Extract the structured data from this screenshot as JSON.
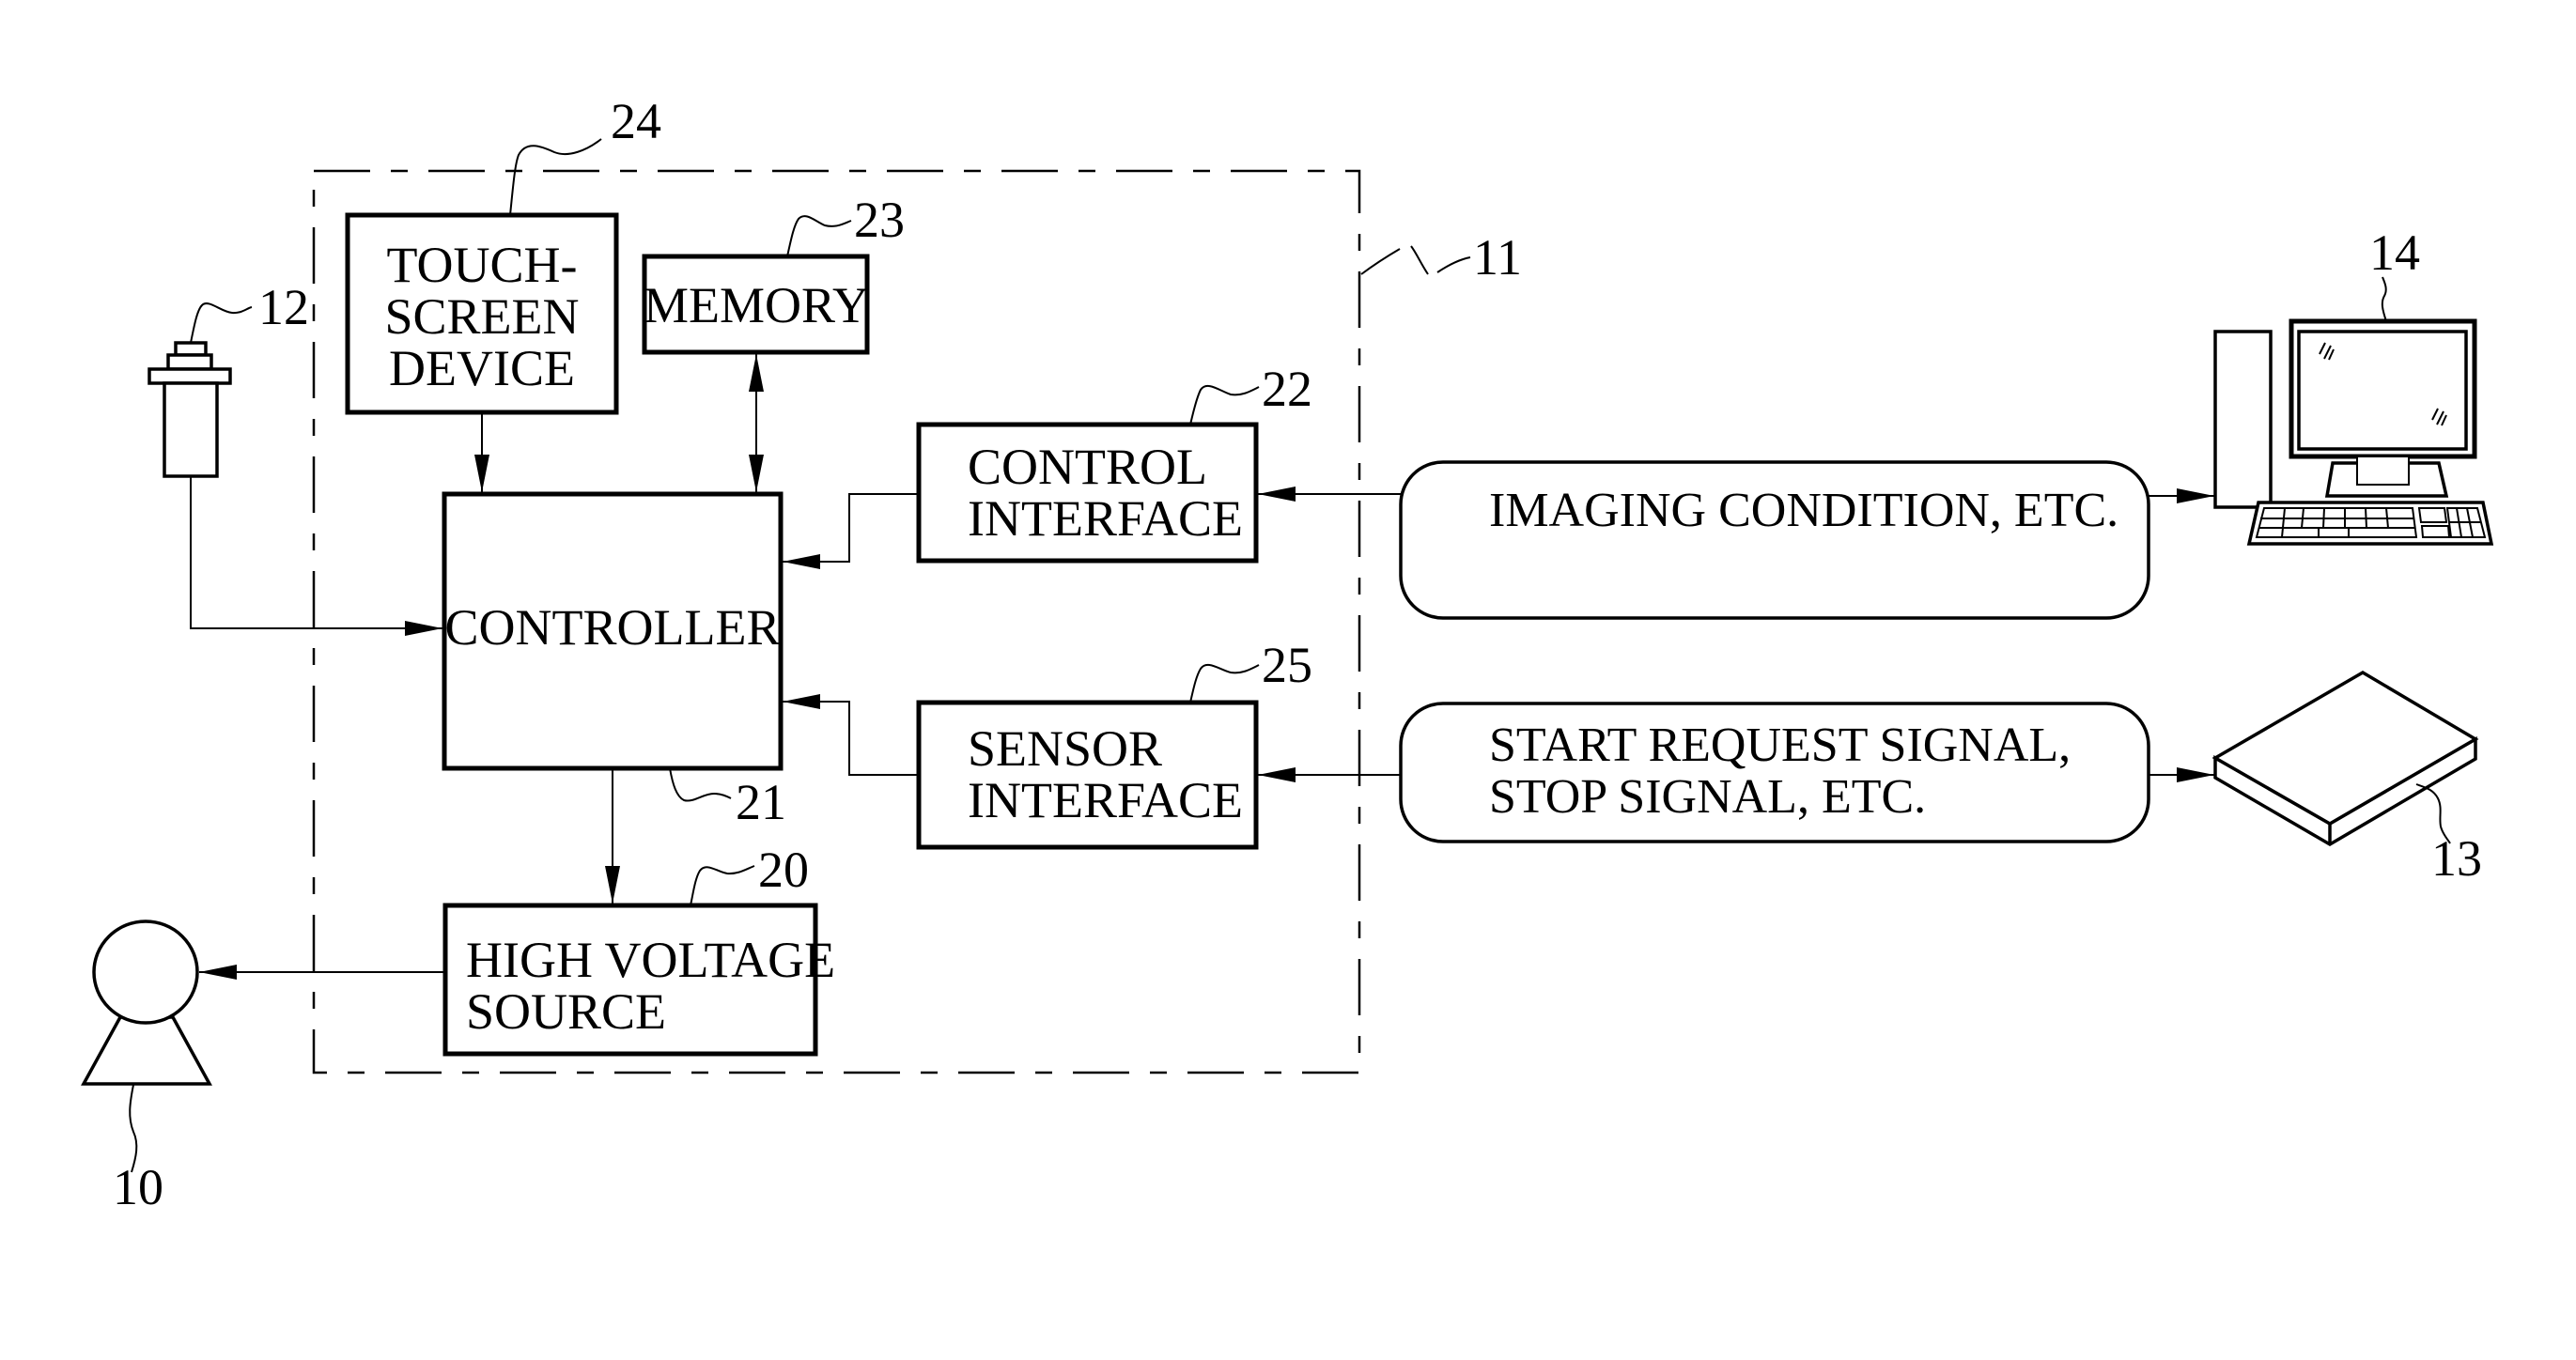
{
  "figure": {
    "enclosure": {
      "ref": "11"
    },
    "blocks": {
      "touchscreen": {
        "ref": "24",
        "lines": [
          "TOUCH-",
          "SCREEN",
          "DEVICE"
        ]
      },
      "memory": {
        "ref": "23",
        "lines": [
          "MEMORY"
        ]
      },
      "controller": {
        "ref": "21",
        "lines": [
          "CONTROLLER"
        ]
      },
      "control_interface": {
        "ref": "22",
        "lines": [
          "CONTROL",
          "INTERFACE"
        ]
      },
      "sensor_interface": {
        "ref": "25",
        "lines": [
          "SENSOR",
          "INTERFACE"
        ]
      },
      "high_voltage_source": {
        "ref": "20",
        "lines": [
          "HIGH VOLTAGE",
          "SOURCE"
        ]
      }
    },
    "external": {
      "xray_tube": {
        "ref": "10"
      },
      "sensor": {
        "ref": "12"
      },
      "detector": {
        "ref": "13"
      },
      "console": {
        "ref": "14"
      }
    },
    "signals": {
      "imaging": {
        "lines": [
          "IMAGING CONDITION, ETC."
        ]
      },
      "start_stop": {
        "lines": [
          "START REQUEST SIGNAL,",
          "STOP SIGNAL, ETC."
        ]
      }
    }
  }
}
